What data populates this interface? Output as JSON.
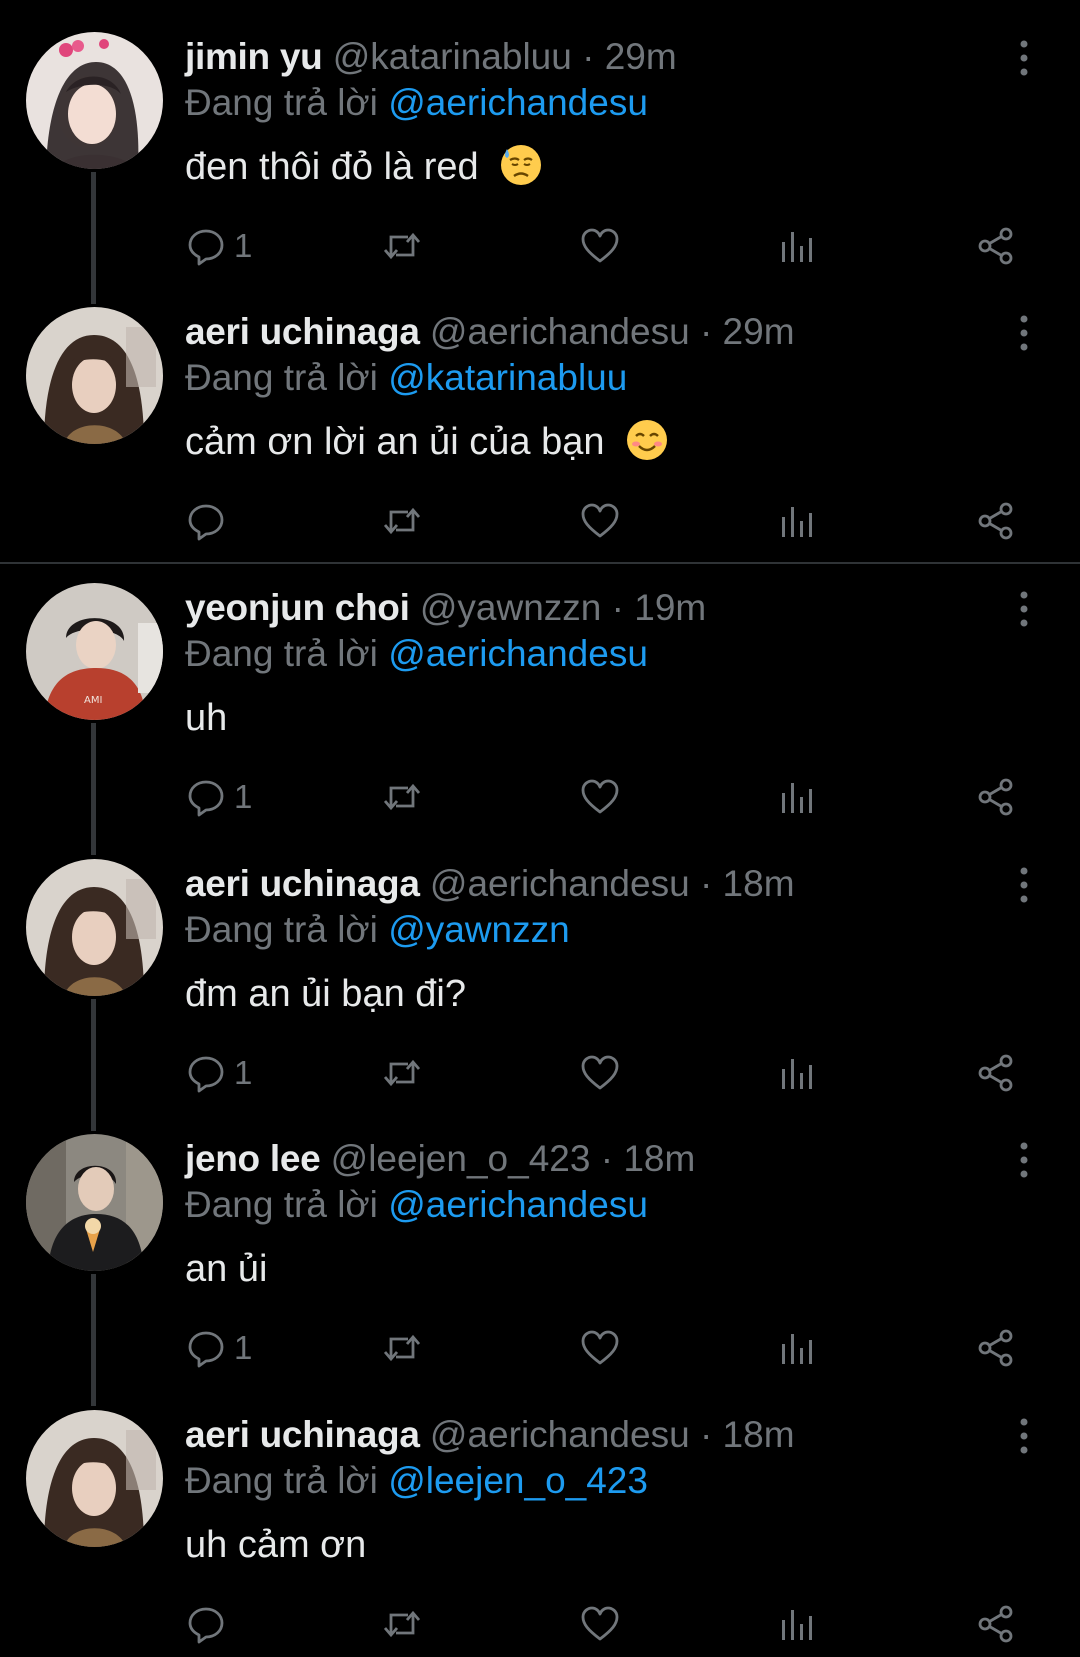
{
  "colors": {
    "background": "#000000",
    "text": "#e7e9ea",
    "secondary": "#71767b",
    "mention": "#1d9bf0",
    "thread_line": "#333639"
  },
  "icons": {
    "reply": "reply-bubble-icon",
    "retweet": "retweet-icon",
    "like": "heart-icon",
    "views": "analytics-icon",
    "share": "share-icon",
    "more": "more-vertical-icon"
  },
  "reply_prefix": "Đang trả lời",
  "tweets": [
    {
      "name": "jimin yu",
      "handle": "@katarinabluu",
      "separator": "·",
      "time": "29m",
      "replying_to": "@aerichandesu",
      "text": "đen thôi đỏ là red",
      "emoji": "downcast-sweat-face",
      "reply_count": "1"
    },
    {
      "name": "aeri uchinaga",
      "handle": "@aerichandesu",
      "separator": "·",
      "time": "29m",
      "replying_to": "@katarinabluu",
      "text": "cảm ơn lời an ủi của bạn",
      "emoji": "smiling-face",
      "reply_count": ""
    },
    {
      "name": "yeonjun choi",
      "handle": "@yawnzzn",
      "separator": "·",
      "time": "19m",
      "replying_to": "@aerichandesu",
      "text": "uh",
      "emoji": "",
      "reply_count": "1"
    },
    {
      "name": "aeri uchinaga",
      "handle": "@aerichandesu",
      "separator": "·",
      "time": "18m",
      "replying_to": "@yawnzzn",
      "text": "đm an ủi bạn đi?",
      "emoji": "",
      "reply_count": "1"
    },
    {
      "name": "jeno lee",
      "handle": "@leejen_o_423",
      "separator": "·",
      "time": "18m",
      "replying_to": "@aerichandesu",
      "text": "an ủi",
      "emoji": "",
      "reply_count": "1"
    },
    {
      "name": "aeri uchinaga",
      "handle": "@aerichandesu",
      "separator": "·",
      "time": "18m",
      "replying_to": "@leejen_o_423",
      "text": "uh cảm ơn",
      "emoji": "",
      "reply_count": ""
    }
  ]
}
